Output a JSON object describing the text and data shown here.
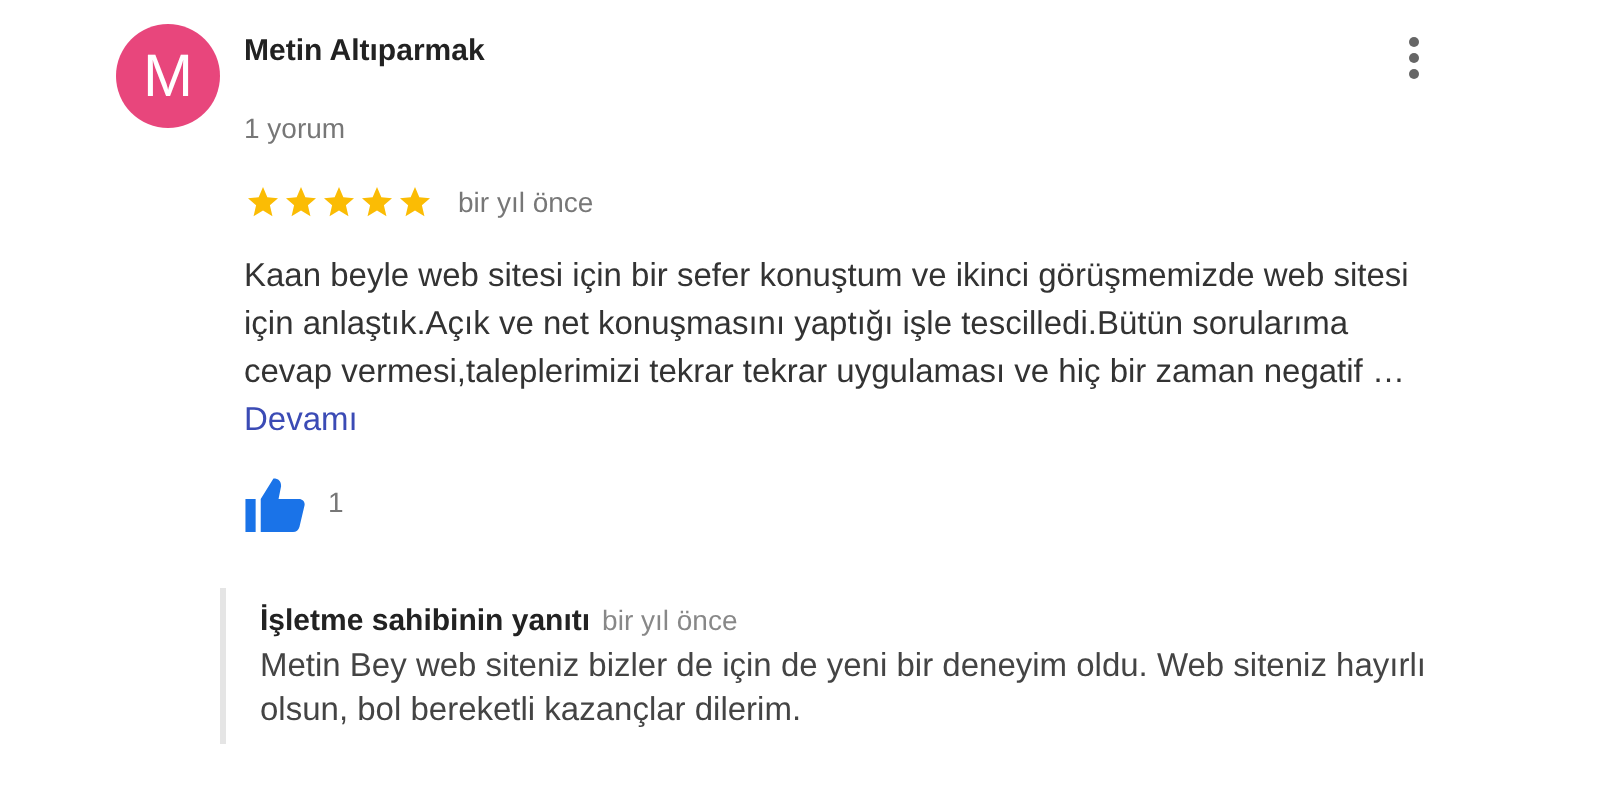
{
  "review": {
    "avatar_letter": "M",
    "author": "Metin Altıparmak",
    "review_count": "1 yorum",
    "stars": 5,
    "time": "bir yıl önce",
    "text": "Kaan beyle web sitesi için bir sefer konuştum ve ikinci görüşmemizde web sitesi için anlaştık.Açık ve net konuşmasını yaptığı işle tescilledi.Bütün sorularıma cevap vermesi,taleplerimizi tekrar tekrar uygulaması ve hiç bir zaman negatif …",
    "more_link": "Devamı",
    "likes": "1"
  },
  "owner_reply": {
    "title": "İşletme sahibinin yanıtı",
    "time": "bir yıl önce",
    "text": "Metin Bey web siteniz bizler de için de yeni bir deneyim oldu. Web siteniz hayırlı olsun, bol bereketli kazançlar dilerim."
  }
}
